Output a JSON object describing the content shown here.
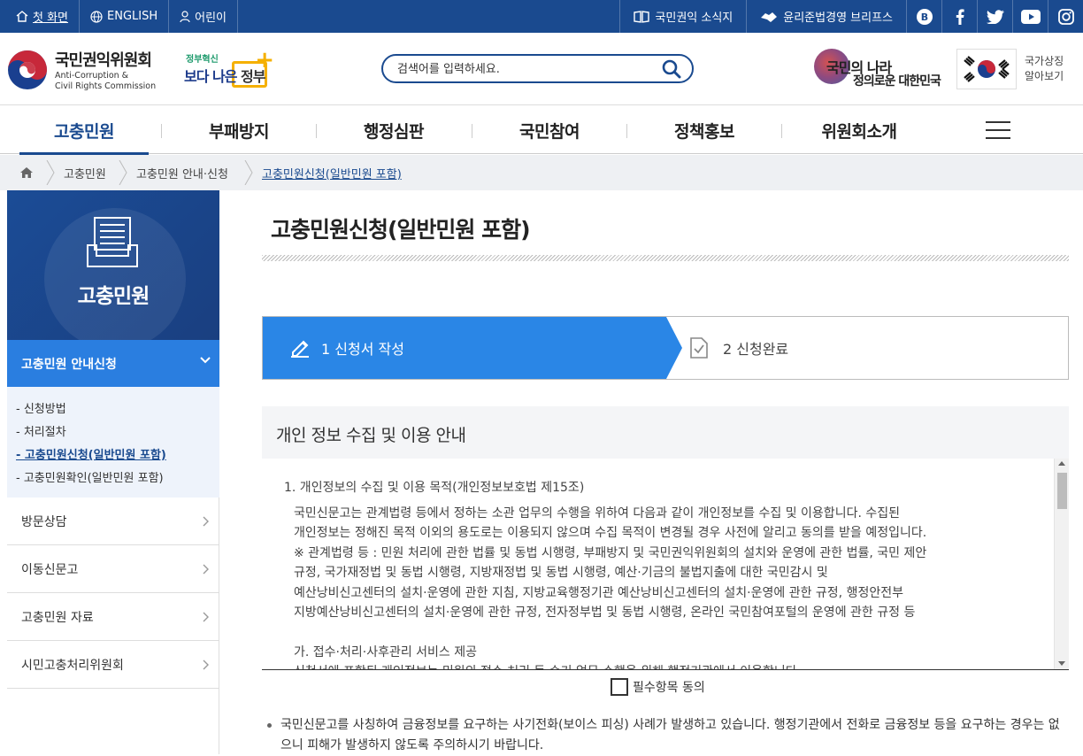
{
  "topbar": {
    "home": "첫 화면",
    "english": "ENGLISH",
    "kids": "어린이",
    "news": "국민권익 소식지",
    "ethics": "윤리준법경영 브리프스",
    "sns": [
      "blog-icon",
      "facebook-icon",
      "twitter-icon",
      "youtube-icon",
      "instagram-icon"
    ]
  },
  "header": {
    "org_ko": "국민권익위원회",
    "org_en_1": "Anti-Corruption &",
    "org_en_2": "Civil Rights Commission",
    "gov_small": "정부혁신",
    "gov_big_1": "보다 나은",
    "gov_big_2": "정부",
    "search_placeholder": "검색어를 입력하세요.",
    "slogan_1": "국민의 나라",
    "slogan_2": "정의로운 대한민국",
    "flag_text_1": "국가상징",
    "flag_text_2": "알아보기"
  },
  "gnb": [
    "고충민원",
    "부패방지",
    "행정심판",
    "국민참여",
    "정책홍보",
    "위원회소개"
  ],
  "breadcrumb": [
    "고충민원",
    "고충민원 안내·신청",
    "고충민원신청(일반민원 포함)"
  ],
  "lnb": {
    "title": "고충민원",
    "sub_title": "고충민원 안내신청",
    "sub_items": [
      "- 신청방법",
      "- 처리절차",
      "- 고충민원신청(일반민원 포함)",
      "- 고충민원확인(일반민원 포함)"
    ],
    "items": [
      "방문상담",
      "이동신문고",
      "고충민원 자료",
      "시민고충처리위원회"
    ]
  },
  "main": {
    "title": "고충민원신청(일반민원 포함)",
    "step1": "1 신청서 작성",
    "step2": "2 신청완료",
    "privacy_title": "개인 정보 수집 및 이용 안내",
    "privacy_h1": "1. 개인정보의 수집 및 이용 목적(개인정보보호법 제15조)",
    "privacy_lines": [
      "국민신문고는 관계법령 등에서 정하는 소관 업무의 수행을 위하여 다음과 같이 개인정보를 수집 및 이용합니다. 수집된",
      "개인정보는 정해진 목적 이외의 용도로는 이용되지 않으며 수집 목적이 변경될 경우 사전에 알리고 동의를 받을 예정입니다.",
      "※ 관계법령 등 : 민원 처리에 관한 법률 및 동법 시행령, 부패방지 및 국민권익위원회의 설치와 운영에 관한 법률, 국민 제안",
      "규정, 국가재정법 및 동법 시행령, 지방재정법 및 동법 시행령, 예산·기금의 불법지출에 대한 국민감시 및",
      "예산낭비신고센터의 설치·운영에 관한 지침, 지방교육행정기관 예산낭비신고센터의 설치·운영에 관한 규정, 행정안전부",
      "지방예산낭비신고센터의 설치·운영에 관한 규정, 전자정부법 및 동법 시행령, 온라인 국민참여포털의 운영에 관한 규정 등"
    ],
    "privacy_sub": "가. 접수·처리·사후관리 서비스 제공",
    "privacy_cut": "신청서에 포함된 개인정보는 민원의 접수·처리 등 순기 업무 수행을 위해 행정기관에서 이용합니다.",
    "agree_label": "필수항목 동의",
    "notice": "국민신문고를 사칭하여 금융정보를 요구하는 사기전화(보이스 피싱) 사례가 발생하고 있습니다. 행정기관에서 전화로 금융정보 등을 요구하는 경우는 없으니 피해가 발생하지 않도록 주의하시기 바랍니다."
  },
  "colors": {
    "brand": "#1a4a8f",
    "step_active": "#2a86e6",
    "lnb_sub": "#2a7ee0"
  }
}
